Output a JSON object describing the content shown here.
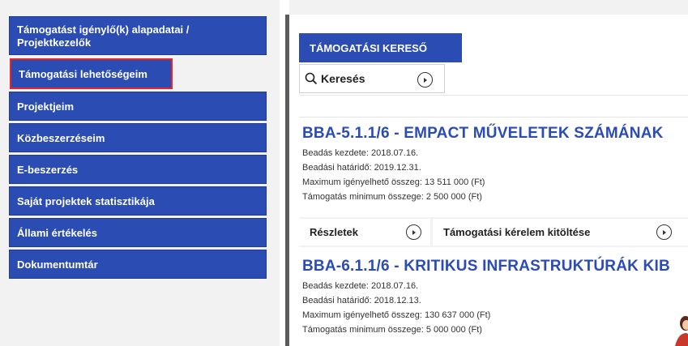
{
  "sidebar": {
    "items": [
      {
        "label": "Támogatást igénylő(k) alapadatai / Projektkezelők"
      },
      {
        "label": "Támogatási lehetőségeim"
      },
      {
        "label": "Projektjeim"
      },
      {
        "label": "Közbeszerzéseim"
      },
      {
        "label": "E-beszerzés"
      },
      {
        "label": "Saját projektek statisztikája"
      },
      {
        "label": "Állami értékelés"
      },
      {
        "label": "Dokumentumtár"
      }
    ]
  },
  "finder": {
    "header": "TÁMOGATÁSI KERESŐ",
    "search_label": "Keresés"
  },
  "results": [
    {
      "title": "BBA-5.1.1/6 - EMPACT MŰVELETEK SZÁMÁNAK",
      "start": "Beadás kezdete: 2018.07.16.",
      "deadline": "Beadási határidő: 2019.12.31.",
      "max": "Maximum igényelhető összeg: 13 511 000 (Ft)",
      "min": "Támogatás minimum összege: 2 500 000 (Ft)",
      "actions": {
        "details": "Részletek",
        "fill": "Támogatási kérelem kitöltése"
      }
    },
    {
      "title": "BBA-6.1.1/6 - KRITIKUS INFRASTRUKTÚRÁK KIB",
      "start": "Beadás kezdete: 2018.07.16.",
      "deadline": "Beadási határidő: 2018.12.13.",
      "max": "Maximum igényelhető összeg: 130 637 000 (Ft)",
      "min": "Támogatás minimum összege: 5 000 000 (Ft)"
    }
  ],
  "colors": {
    "accent": "#2b4cb2",
    "highlight": "#e3262a"
  },
  "icons": [
    "search-icon",
    "circle-arrow-icon"
  ]
}
